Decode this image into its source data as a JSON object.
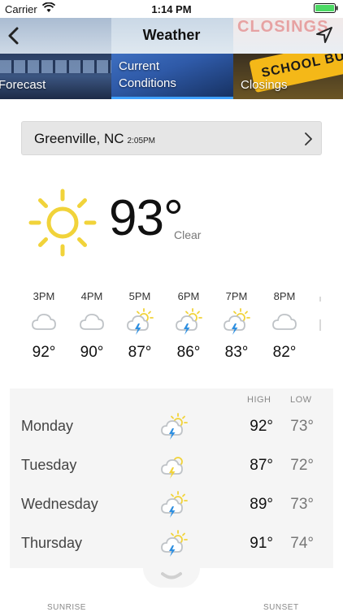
{
  "status": {
    "carrier": "Carrier",
    "time": "1:14 PM"
  },
  "header": {
    "title": "Weather",
    "closings_bg_text": "CLOSINGS"
  },
  "tabs": [
    {
      "label": "Forecast"
    },
    {
      "label_line1": "Current",
      "label_line2": "Conditions"
    },
    {
      "label": "Closings",
      "bus_text": "SCHOOL BUS"
    }
  ],
  "location": {
    "city": "Greenville, NC",
    "time": "2:05PM"
  },
  "current": {
    "temp": "93°",
    "condition": "Clear",
    "icon": "sun-icon"
  },
  "hourly": [
    {
      "time": "3PM",
      "temp": "92°",
      "icon": "cloud-icon"
    },
    {
      "time": "4PM",
      "temp": "90°",
      "icon": "cloud-icon"
    },
    {
      "time": "5PM",
      "temp": "87°",
      "icon": "thunderstorm-sun-icon"
    },
    {
      "time": "6PM",
      "temp": "86°",
      "icon": "thunderstorm-sun-icon"
    },
    {
      "time": "7PM",
      "temp": "83°",
      "icon": "thunderstorm-sun-icon"
    },
    {
      "time": "8PM",
      "temp": "82°",
      "icon": "cloud-icon"
    }
  ],
  "daily_header": {
    "high": "HIGH",
    "low": "LOW"
  },
  "daily": [
    {
      "day": "Monday",
      "high": "92°",
      "low": "73°",
      "icon": "thunderstorm-sun-icon"
    },
    {
      "day": "Tuesday",
      "high": "87°",
      "low": "72°",
      "icon": "thunderstorm-icon"
    },
    {
      "day": "Wednesday",
      "high": "89°",
      "low": "73°",
      "icon": "thunderstorm-sun-icon"
    },
    {
      "day": "Thursday",
      "high": "91°",
      "low": "74°",
      "icon": "thunderstorm-sun-icon"
    }
  ],
  "footer": {
    "sunrise": "SUNRISE",
    "sunset": "SUNSET"
  },
  "colors": {
    "sun": "#F1D33A",
    "bolt": "#2E8FE0",
    "cloud": "#BFC3C7",
    "accent": "#3FA1FF"
  }
}
